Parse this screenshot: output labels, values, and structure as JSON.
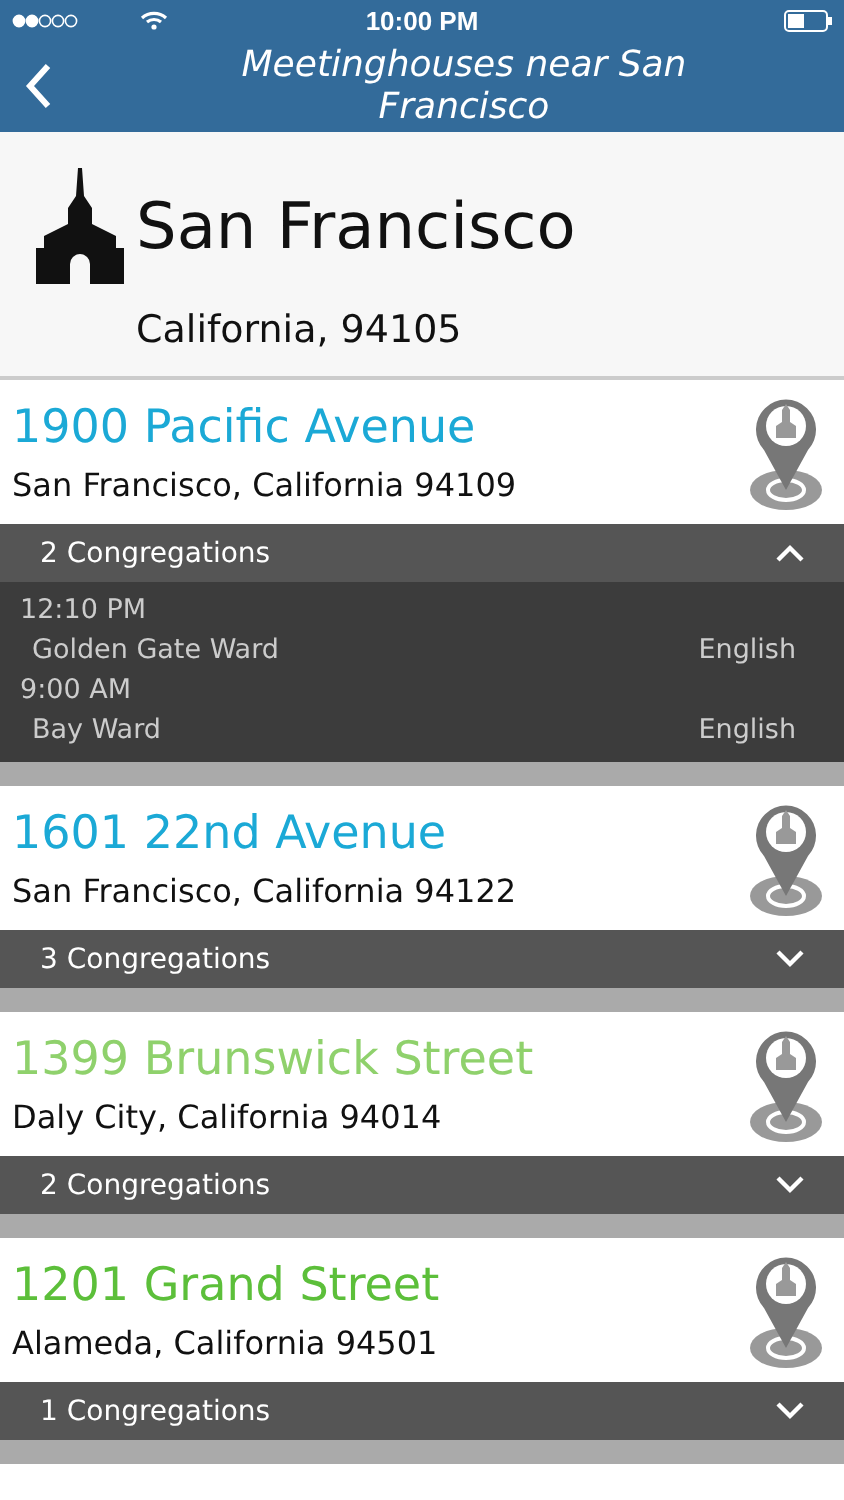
{
  "status_bar": {
    "time": "10:00 PM"
  },
  "nav": {
    "title": "Meetinghouses near San Francisco"
  },
  "location": {
    "city": "San Francisco",
    "region": "California, 94105"
  },
  "meetinghouses": [
    {
      "street": "1900 Pacific Avenue",
      "city": "San Francisco, California 94109",
      "color": "#1ba9d6",
      "count": "2 Congregations",
      "expanded": true,
      "congregations": [
        {
          "time": "12:10 PM",
          "name": "Golden Gate Ward",
          "language": "English"
        },
        {
          "time": "9:00 AM",
          "name": "Bay Ward",
          "language": "English"
        }
      ]
    },
    {
      "street": "1601 22nd Avenue",
      "city": "San Francisco, California 94122",
      "color": "#1ba9d6",
      "count": "3 Congregations",
      "expanded": false
    },
    {
      "street": "1399 Brunswick Street",
      "city": "Daly City, California 94014",
      "color": "#8fd16c",
      "count": "2 Congregations",
      "expanded": false
    },
    {
      "street": "1201 Grand Street",
      "city": "Alameda, California 94501",
      "color": "#5cbf3a",
      "count": "1 Congregations",
      "expanded": false
    }
  ]
}
